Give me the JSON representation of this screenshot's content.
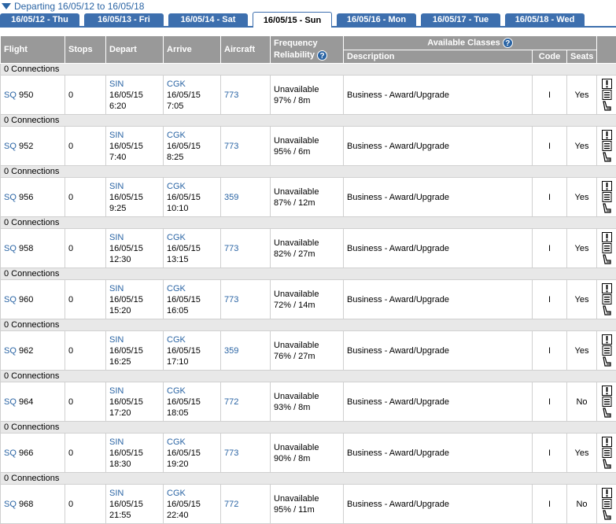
{
  "header": {
    "title": "Departing 16/05/12 to 16/05/18"
  },
  "tabs": [
    {
      "label": "16/05/12 - Thu"
    },
    {
      "label": "16/05/13 - Fri"
    },
    {
      "label": "16/05/14 - Sat"
    },
    {
      "label": "16/05/15 - Sun",
      "active": true
    },
    {
      "label": "16/05/16 - Mon"
    },
    {
      "label": "16/05/17 - Tue"
    },
    {
      "label": "16/05/18 - Wed"
    }
  ],
  "columns": {
    "flight": "Flight",
    "stops": "Stops",
    "depart": "Depart",
    "arrive": "Arrive",
    "aircraft": "Aircraft",
    "frequency": "Frequency",
    "reliability": "Reliability",
    "available_classes": "Available Classes",
    "description": "Description",
    "code": "Code",
    "seats": "Seats"
  },
  "rows": [
    {
      "connections": "0 Connections",
      "airline": "SQ",
      "number": "950",
      "stops": "0",
      "dep_code": "SIN",
      "dep_date": "16/05/15",
      "dep_time": "6:20",
      "arr_code": "CGK",
      "arr_date": "16/05/15",
      "arr_time": "7:05",
      "aircraft": "773",
      "frequency": "Unavailable",
      "reliability": "97% / 8m",
      "description": "Business - Award/Upgrade",
      "code": "I",
      "seats": "Yes"
    },
    {
      "connections": "0 Connections",
      "airline": "SQ",
      "number": "952",
      "stops": "0",
      "dep_code": "SIN",
      "dep_date": "16/05/15",
      "dep_time": "7:40",
      "arr_code": "CGK",
      "arr_date": "16/05/15",
      "arr_time": "8:25",
      "aircraft": "773",
      "frequency": "Unavailable",
      "reliability": "95% / 6m",
      "description": "Business - Award/Upgrade",
      "code": "I",
      "seats": "Yes"
    },
    {
      "connections": "0 Connections",
      "airline": "SQ",
      "number": "956",
      "stops": "0",
      "dep_code": "SIN",
      "dep_date": "16/05/15",
      "dep_time": "9:25",
      "arr_code": "CGK",
      "arr_date": "16/05/15",
      "arr_time": "10:10",
      "aircraft": "359",
      "frequency": "Unavailable",
      "reliability": "87% / 12m",
      "description": "Business - Award/Upgrade",
      "code": "I",
      "seats": "Yes"
    },
    {
      "connections": "0 Connections",
      "airline": "SQ",
      "number": "958",
      "stops": "0",
      "dep_code": "SIN",
      "dep_date": "16/05/15",
      "dep_time": "12:30",
      "arr_code": "CGK",
      "arr_date": "16/05/15",
      "arr_time": "13:15",
      "aircraft": "773",
      "frequency": "Unavailable",
      "reliability": "82% / 27m",
      "description": "Business - Award/Upgrade",
      "code": "I",
      "seats": "Yes"
    },
    {
      "connections": "0 Connections",
      "airline": "SQ",
      "number": "960",
      "stops": "0",
      "dep_code": "SIN",
      "dep_date": "16/05/15",
      "dep_time": "15:20",
      "arr_code": "CGK",
      "arr_date": "16/05/15",
      "arr_time": "16:05",
      "aircraft": "773",
      "frequency": "Unavailable",
      "reliability": "72% / 14m",
      "description": "Business - Award/Upgrade",
      "code": "I",
      "seats": "Yes"
    },
    {
      "connections": "0 Connections",
      "airline": "SQ",
      "number": "962",
      "stops": "0",
      "dep_code": "SIN",
      "dep_date": "16/05/15",
      "dep_time": "16:25",
      "arr_code": "CGK",
      "arr_date": "16/05/15",
      "arr_time": "17:10",
      "aircraft": "359",
      "frequency": "Unavailable",
      "reliability": "76% / 27m",
      "description": "Business - Award/Upgrade",
      "code": "I",
      "seats": "Yes"
    },
    {
      "connections": "0 Connections",
      "airline": "SQ",
      "number": "964",
      "stops": "0",
      "dep_code": "SIN",
      "dep_date": "16/05/15",
      "dep_time": "17:20",
      "arr_code": "CGK",
      "arr_date": "16/05/15",
      "arr_time": "18:05",
      "aircraft": "772",
      "frequency": "Unavailable",
      "reliability": "93% / 8m",
      "description": "Business - Award/Upgrade",
      "code": "I",
      "seats": "No"
    },
    {
      "connections": "0 Connections",
      "airline": "SQ",
      "number": "966",
      "stops": "0",
      "dep_code": "SIN",
      "dep_date": "16/05/15",
      "dep_time": "18:30",
      "arr_code": "CGK",
      "arr_date": "16/05/15",
      "arr_time": "19:20",
      "aircraft": "773",
      "frequency": "Unavailable",
      "reliability": "90% / 8m",
      "description": "Business - Award/Upgrade",
      "code": "I",
      "seats": "Yes"
    },
    {
      "connections": "0 Connections",
      "airline": "SQ",
      "number": "968",
      "stops": "0",
      "dep_code": "SIN",
      "dep_date": "16/05/15",
      "dep_time": "21:55",
      "arr_code": "CGK",
      "arr_date": "16/05/15",
      "arr_time": "22:40",
      "aircraft": "772",
      "frequency": "Unavailable",
      "reliability": "95% / 11m",
      "description": "Business - Award/Upgrade",
      "code": "I",
      "seats": "No"
    }
  ],
  "icons": {
    "help": "help-circle-icon",
    "alert": "alert-icon",
    "details": "details-list-icon",
    "seat": "seat-icon"
  },
  "colors": {
    "accent": "#3d6fae",
    "link": "#2a64a4",
    "header_bg": "#999999",
    "connection_bg": "#e8e8e8"
  }
}
